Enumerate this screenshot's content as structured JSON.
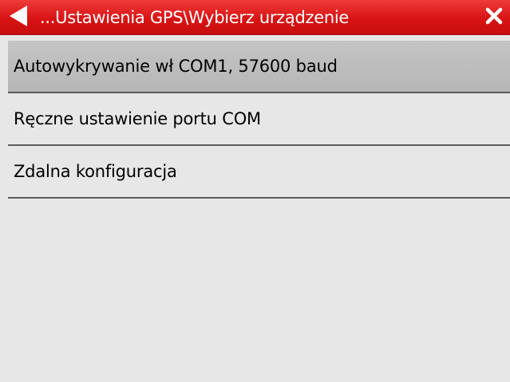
{
  "header": {
    "title": "...Ustawienia GPS\\Wybierz urządzenie",
    "back_icon": "back-arrow-icon",
    "close_icon": "close-icon",
    "accent_color": "#d81414"
  },
  "list": {
    "items": [
      {
        "label": "Autowykrywanie wł COM1, 57600 baud",
        "selected": true
      },
      {
        "label": "Ręczne ustawienie portu COM",
        "selected": false
      },
      {
        "label": "Zdalna konfiguracja",
        "selected": false
      }
    ]
  }
}
